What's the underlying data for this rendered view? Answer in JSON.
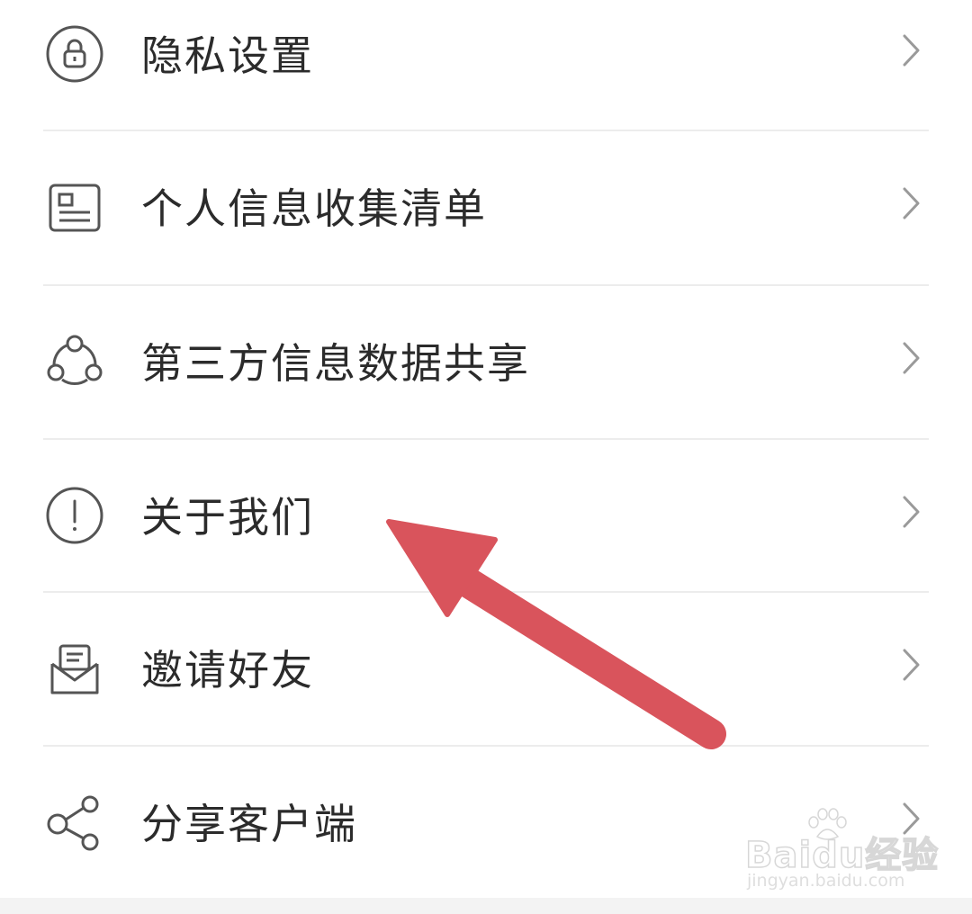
{
  "menu": {
    "items": [
      {
        "label": "隐私设置",
        "icon": "lock-icon"
      },
      {
        "label": "个人信息收集清单",
        "icon": "document-list-icon"
      },
      {
        "label": "第三方信息数据共享",
        "icon": "share-nodes-icon"
      },
      {
        "label": "关于我们",
        "icon": "exclamation-circle-icon"
      },
      {
        "label": "邀请好友",
        "icon": "envelope-icon"
      },
      {
        "label": "分享客户端",
        "icon": "share-icon"
      }
    ]
  },
  "colors": {
    "text": "#2b2b2b",
    "icon": "#555555",
    "chevron": "#9a9a9a",
    "divider": "#ececec",
    "annotation_arrow": "#d9545c"
  },
  "watermark": {
    "brand": "Baidu经验",
    "domain": "jingyan.baidu.com"
  }
}
